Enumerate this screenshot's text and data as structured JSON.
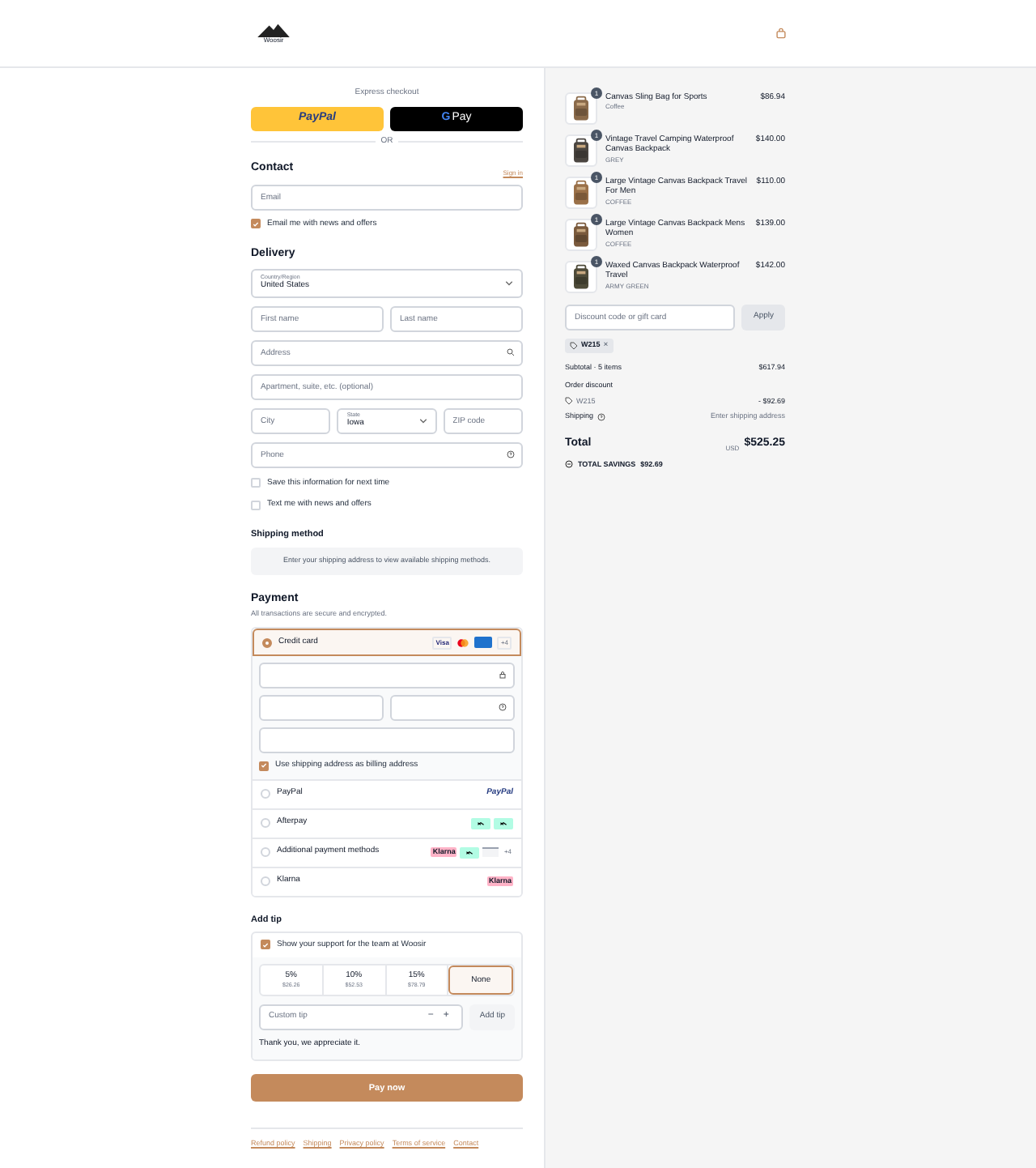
{
  "header": {
    "logo": "Woosir"
  },
  "express": {
    "title": "Express checkout",
    "paypal": "PayPal",
    "gpay_g": "G",
    "gpay": "Pay",
    "or": "OR"
  },
  "contact": {
    "title": "Contact",
    "sign_in": "Sign in",
    "email": {
      "placeholder": "Email"
    },
    "news": {
      "label": "Email me with news and offers",
      "checked": true
    }
  },
  "delivery": {
    "title": "Delivery",
    "country": {
      "label": "Country/Region",
      "value": "United States"
    },
    "first": {
      "placeholder": "First name"
    },
    "last": {
      "placeholder": "Last name"
    },
    "address": {
      "placeholder": "Address"
    },
    "apartment": {
      "placeholder": "Apartment, suite, etc. (optional)"
    },
    "city": {
      "placeholder": "City"
    },
    "state": {
      "label": "State",
      "value": "Iowa"
    },
    "zip": {
      "placeholder": "ZIP code"
    },
    "phone": {
      "placeholder": "Phone"
    },
    "options": [
      {
        "label": "Save this information for next time",
        "checked": false
      },
      {
        "label": "Text me with news and offers",
        "checked": false
      }
    ]
  },
  "shipping_method": {
    "title": "Shipping method",
    "note": "Enter your shipping address to view available shipping methods."
  },
  "payment": {
    "title": "Payment",
    "subtitle": "All transactions are secure and encrypted.",
    "methods": [
      {
        "kind": "card",
        "label": "Credit card",
        "selected": true,
        "badges": [
          "Visa",
          "+4"
        ],
        "billing": {
          "label": "Use shipping address as billing address",
          "checked": true
        }
      },
      {
        "kind": "paypal",
        "label": "PayPal",
        "selected": false,
        "badges": [
          "PayPal"
        ]
      },
      {
        "kind": "afterpay",
        "label": "Afterpay",
        "selected": false
      },
      {
        "kind": "additional",
        "label": "Additional payment methods",
        "selected": false,
        "badges": [
          "Klarna",
          "+4"
        ]
      },
      {
        "kind": "klarna",
        "label": "Klarna",
        "selected": false,
        "badges": [
          "Klarna"
        ]
      }
    ]
  },
  "tip": {
    "title": "Add tip",
    "support": {
      "label": "Show your support for the team at Woosir",
      "checked": true
    },
    "options": [
      {
        "percent": "5%",
        "amount": "$26.26",
        "selected": false
      },
      {
        "percent": "10%",
        "amount": "$52.53",
        "selected": false
      },
      {
        "percent": "15%",
        "amount": "$78.79",
        "selected": false
      },
      {
        "percent": "None",
        "selected": true
      }
    ],
    "custom": {
      "placeholder": "Custom tip",
      "minus": "−",
      "plus": "+"
    },
    "add": "Add tip",
    "thanks": "Thank you, we appreciate it."
  },
  "pay": "Pay now",
  "footer": [
    "Refund policy",
    "Shipping",
    "Privacy policy",
    "Terms of service",
    "Contact"
  ],
  "summary": {
    "items": [
      {
        "qty": "1",
        "name": "Canvas Sling Bag for Sports",
        "variant": "Coffee",
        "price": "$86.94"
      },
      {
        "qty": "1",
        "name": "Vintage Travel Camping Waterproof Canvas Backpack",
        "variant": "GREY",
        "price": "$140.00"
      },
      {
        "qty": "1",
        "name": "Large Vintage Canvas Backpack Travel For Men",
        "variant": "COFFEE",
        "price": "$110.00"
      },
      {
        "qty": "1",
        "name": "Large Vintage Canvas Backpack Mens Women",
        "variant": "COFFEE",
        "price": "$139.00"
      },
      {
        "qty": "1",
        "name": "Waxed Canvas Backpack Waterproof Travel",
        "variant": "ARMY GREEN",
        "price": "$142.00"
      }
    ],
    "discount": {
      "placeholder": "Discount code or gift card",
      "apply": "Apply",
      "code": "W215",
      "remove": "×"
    },
    "subtotal": {
      "label": "Subtotal · 5 items",
      "value": "$617.94"
    },
    "order_discount": {
      "label": "Order discount",
      "code": "W215",
      "value": "- $92.69"
    },
    "shipping": {
      "label": "Shipping",
      "value": "Enter shipping address"
    },
    "total": {
      "label": "Total",
      "currency": "USD",
      "value": "$525.25"
    },
    "savings": {
      "label": "TOTAL SAVINGS",
      "value": "$92.69"
    }
  }
}
